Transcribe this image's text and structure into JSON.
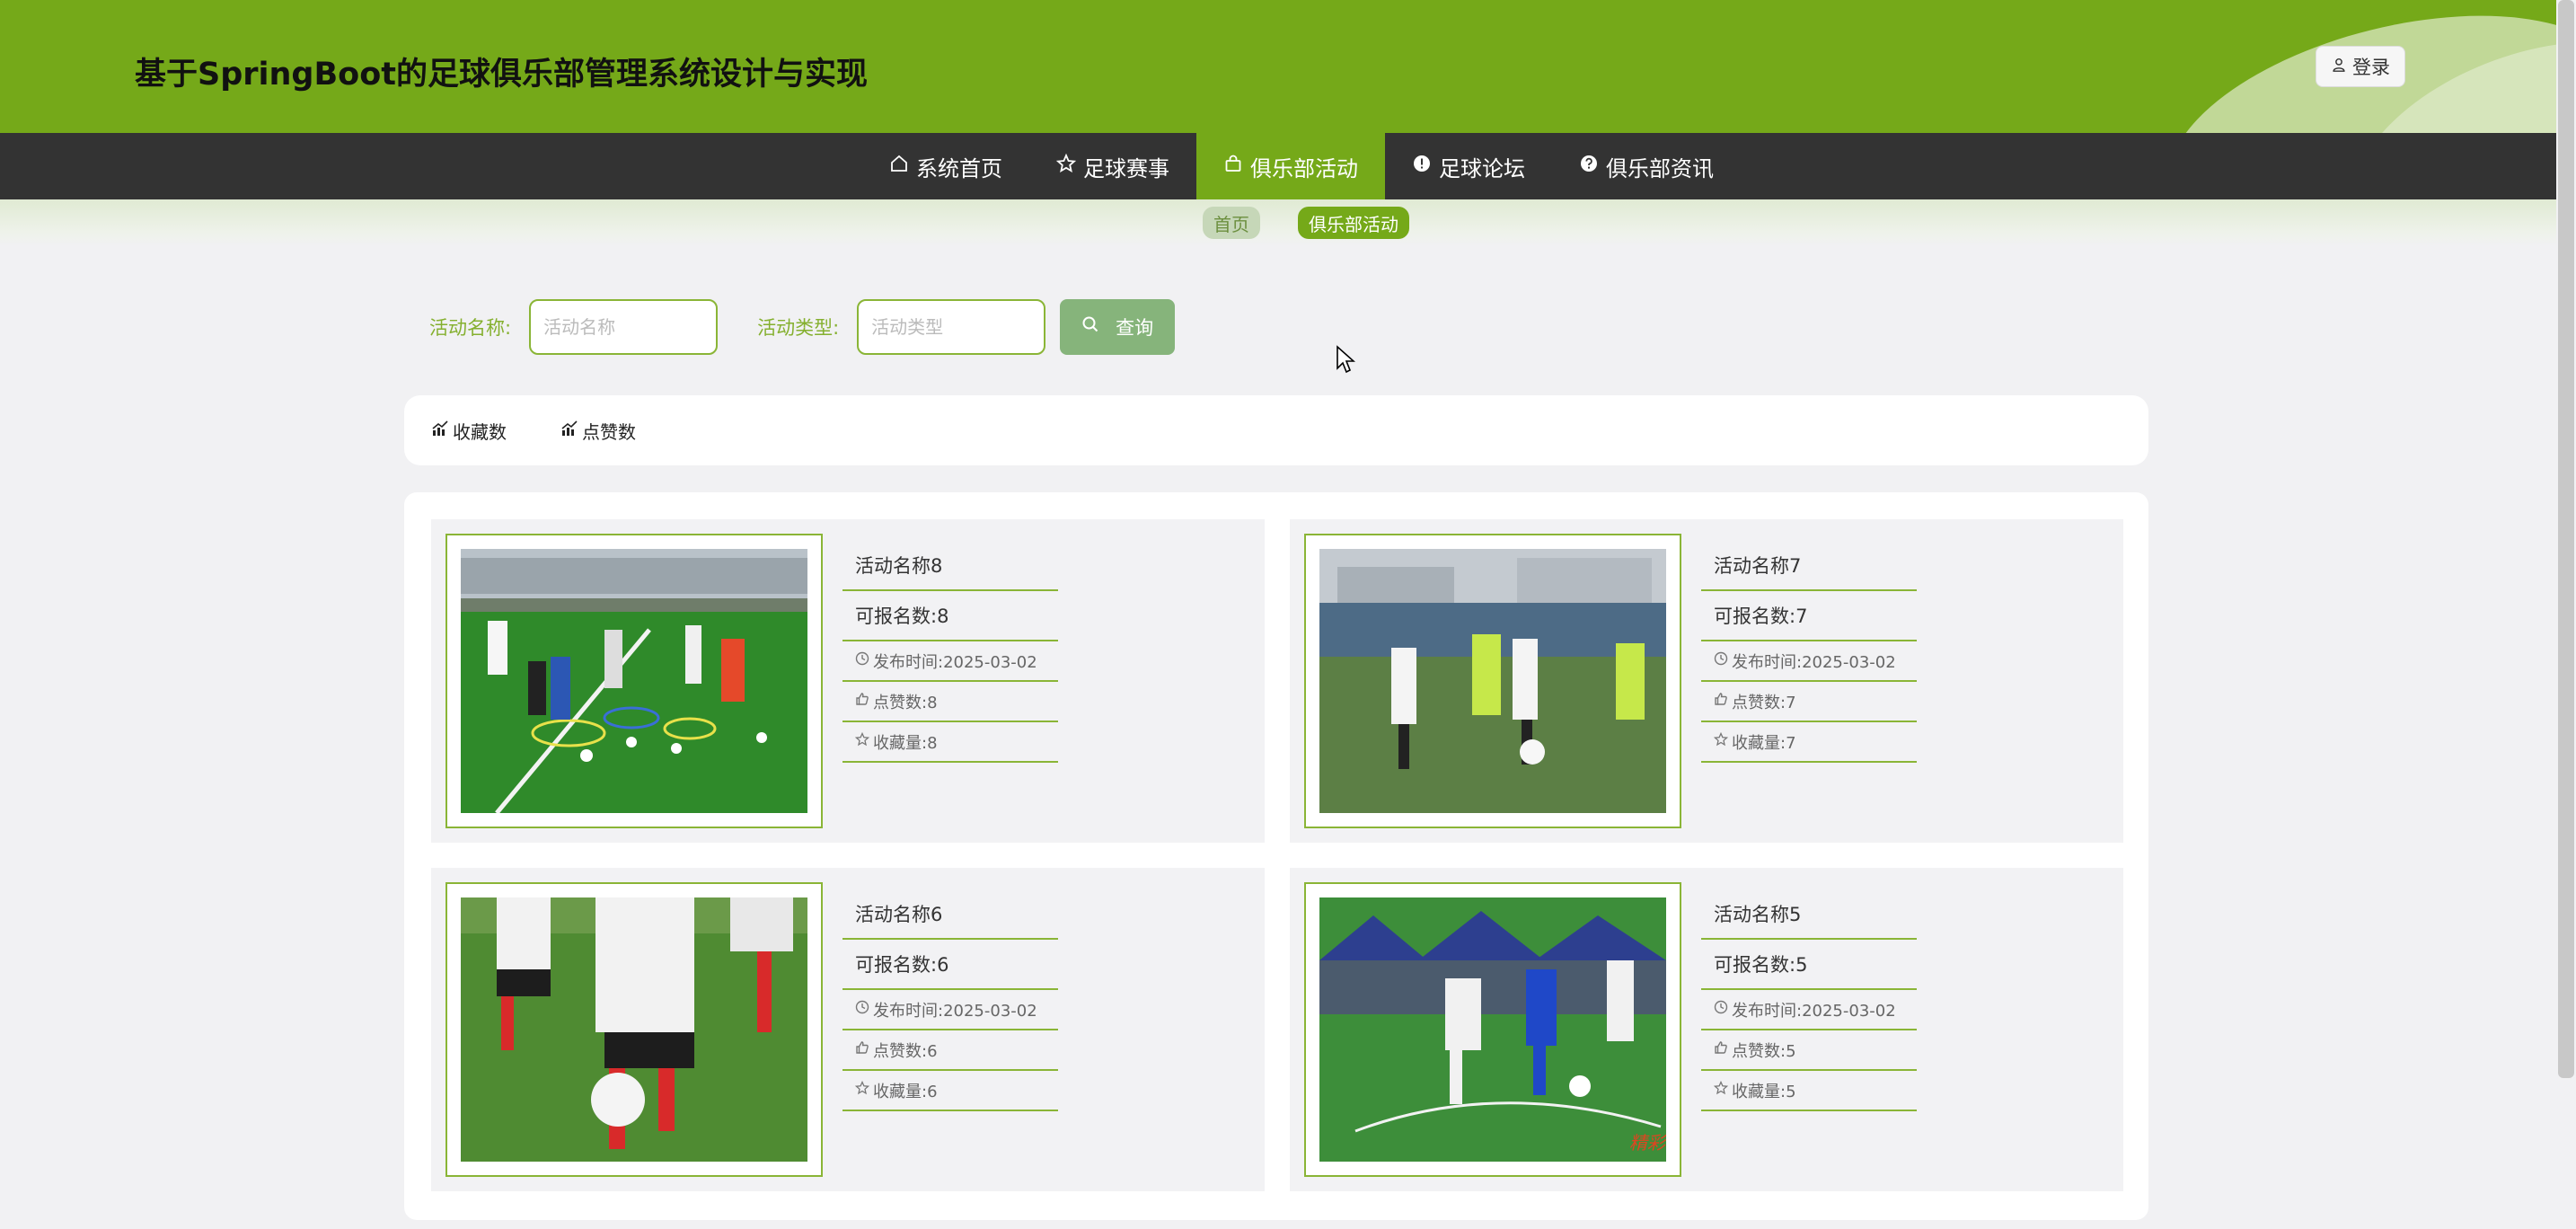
{
  "header": {
    "title": "基于SpringBoot的足球俱乐部管理系统设计与实现",
    "login_label": "登录"
  },
  "nav": {
    "items": [
      {
        "label": "系统首页",
        "icon": "home-icon"
      },
      {
        "label": "足球赛事",
        "icon": "star-icon"
      },
      {
        "label": "俱乐部活动",
        "icon": "bag-icon"
      },
      {
        "label": "足球论坛",
        "icon": "alert-circle-icon"
      },
      {
        "label": "俱乐部资讯",
        "icon": "question-circle-icon"
      }
    ],
    "active_index": 2
  },
  "breadcrumb": {
    "home": "首页",
    "current": "俱乐部活动"
  },
  "search": {
    "name_label": "活动名称:",
    "name_placeholder": "活动名称",
    "type_label": "活动类型:",
    "type_placeholder": "活动类型",
    "button_label": "查询"
  },
  "sort": {
    "favorites": "收藏数",
    "likes": "点赞数"
  },
  "cards": [
    {
      "name": "活动名称8",
      "quota": "可报名数:8",
      "publish": "发布时间:2025-03-02",
      "likes": "点赞数:8",
      "favorites": "收藏量:8"
    },
    {
      "name": "活动名称7",
      "quota": "可报名数:7",
      "publish": "发布时间:2025-03-02",
      "likes": "点赞数:7",
      "favorites": "收藏量:7"
    },
    {
      "name": "活动名称6",
      "quota": "可报名数:6",
      "publish": "发布时间:2025-03-02",
      "likes": "点赞数:6",
      "favorites": "收藏量:6"
    },
    {
      "name": "活动名称5",
      "quota": "可报名数:5",
      "publish": "发布时间:2025-03-02",
      "likes": "点赞数:5",
      "favorites": "收藏量:5"
    }
  ],
  "colors": {
    "brand_green": "#75a919",
    "nav_dark": "#333333",
    "button_green": "#86b47b",
    "page_bg": "#f1f1f3"
  }
}
